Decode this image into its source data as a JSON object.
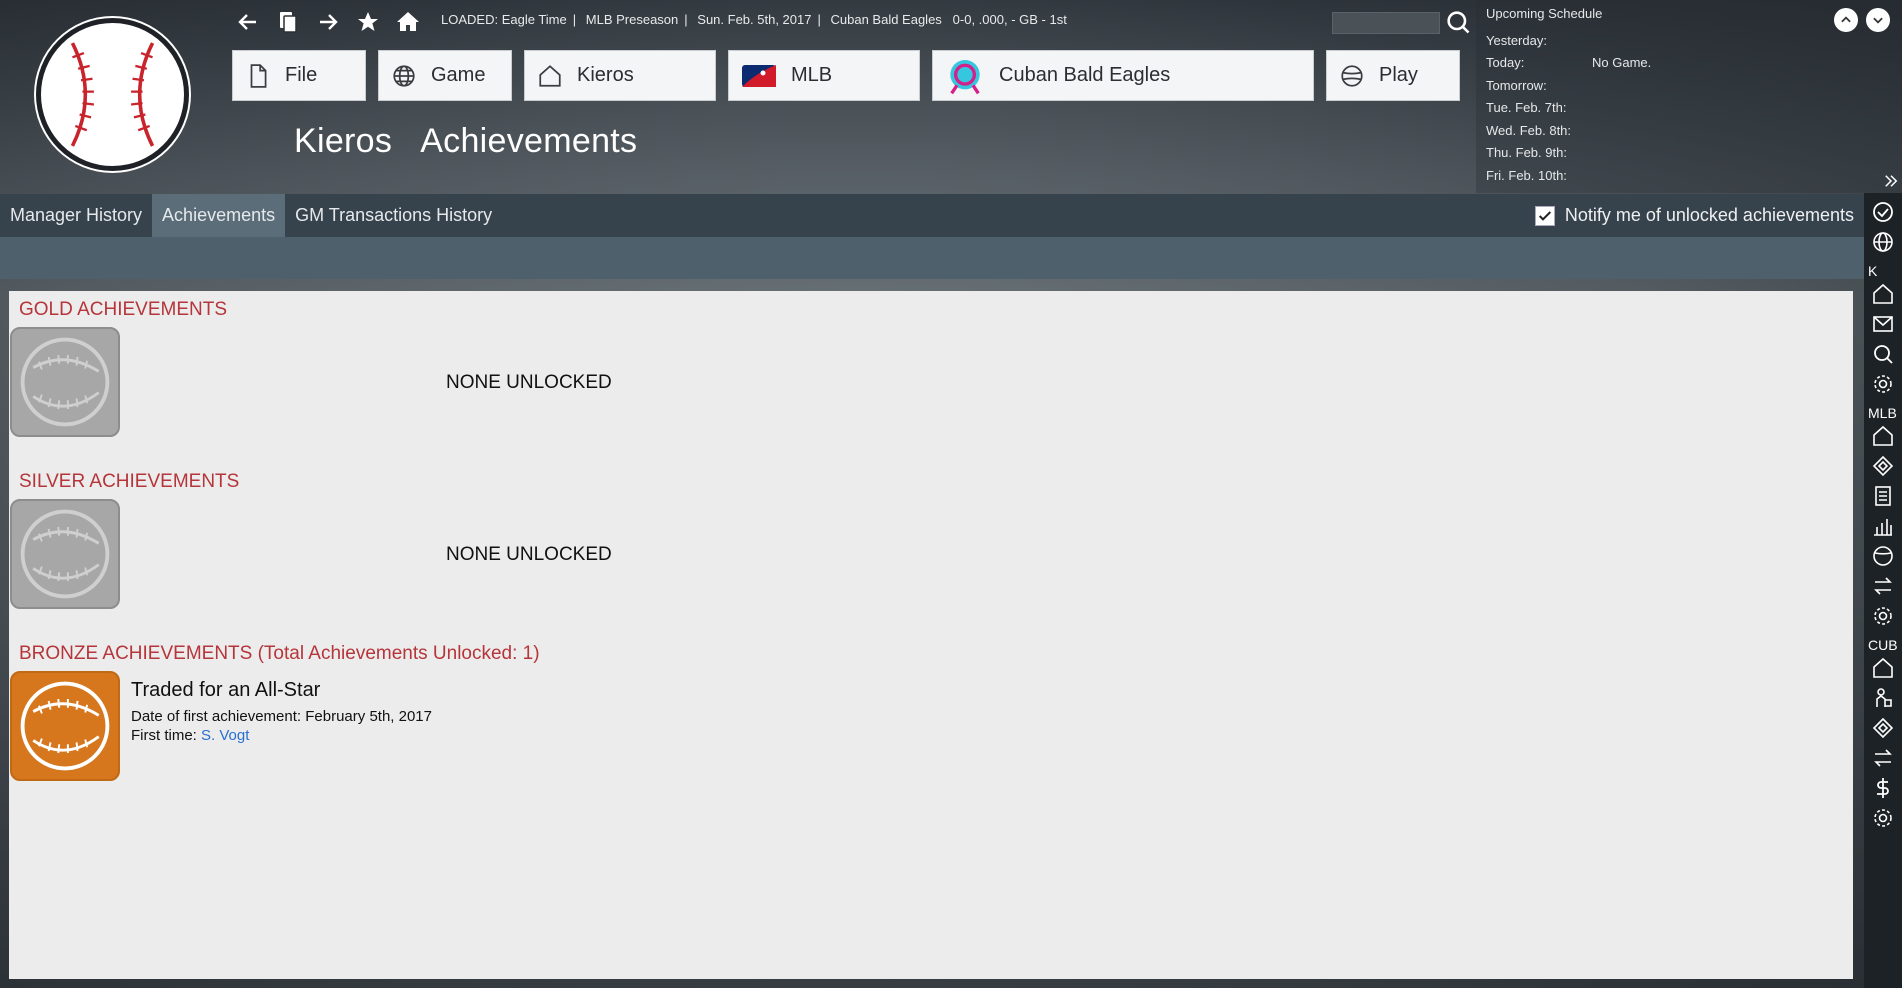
{
  "status": {
    "loaded_label": "LOADED:",
    "save_name": "Eagle Time",
    "phase": "MLB Preseason",
    "date": "Sun. Feb. 5th, 2017",
    "team": "Cuban Bald Eagles",
    "record": "0-0, .000, - GB - 1st"
  },
  "main_buttons": [
    {
      "label": "File",
      "icon": "file-icon"
    },
    {
      "label": "Game",
      "icon": "globe-icon"
    },
    {
      "label": "Kieros",
      "icon": "home-icon"
    },
    {
      "label": "MLB",
      "icon": "mlb-logo"
    },
    {
      "label": "Cuban Bald Eagles",
      "icon": "team-logo"
    },
    {
      "label": "Play",
      "icon": "baseball-icon"
    }
  ],
  "page_title": {
    "name": "Kieros",
    "section": "Achievements"
  },
  "schedule": {
    "title": "Upcoming Schedule",
    "rows": [
      {
        "day": "Yesterday:",
        "value": ""
      },
      {
        "day": "Today:",
        "value": "No Game."
      },
      {
        "day": "Tomorrow:",
        "value": ""
      },
      {
        "day": "Tue. Feb. 7th:",
        "value": ""
      },
      {
        "day": "Wed. Feb. 8th:",
        "value": ""
      },
      {
        "day": "Thu. Feb. 9th:",
        "value": ""
      },
      {
        "day": "Fri. Feb. 10th:",
        "value": ""
      }
    ]
  },
  "tabs": [
    {
      "label": "Manager History",
      "active": false
    },
    {
      "label": "Achievements",
      "active": true
    },
    {
      "label": "GM Transactions History",
      "active": false
    }
  ],
  "notify": {
    "label": "Notify me of unlocked achievements",
    "checked": true
  },
  "sidebar": {
    "group_k": "K",
    "group_mlb": "MLB",
    "group_cub": "CUB"
  },
  "gold": {
    "title": "GOLD ACHIEVEMENTS",
    "empty": "NONE UNLOCKED"
  },
  "silver": {
    "title": "SILVER ACHIEVEMENTS",
    "empty": "NONE UNLOCKED"
  },
  "bronze": {
    "title": "BRONZE ACHIEVEMENTS (Total Achievements Unlocked: 1)",
    "achievement": {
      "name": "Traded for an All-Star",
      "date_label": "Date of first achievement:",
      "date": "February 5th, 2017",
      "first_label": "First time:",
      "first_player": "S. Vogt"
    }
  },
  "colors": {
    "section_title": "#b6353a",
    "bronze": "#d6761d",
    "link": "#2a6fd0"
  }
}
